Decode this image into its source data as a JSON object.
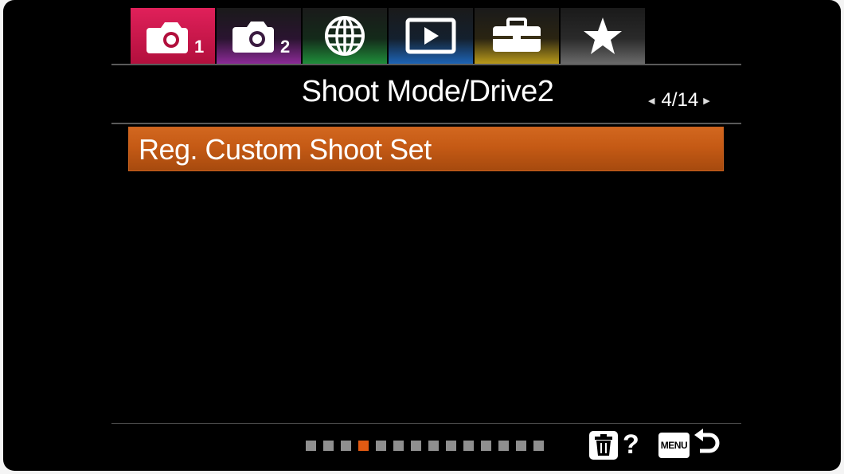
{
  "tabs": [
    {
      "icon": "camera-icon",
      "subscript": "1",
      "color": "#d4174d",
      "active": true
    },
    {
      "icon": "camera-icon",
      "subscript": "2",
      "color": "#8c2a97",
      "active": false
    },
    {
      "icon": "globe-icon",
      "subscript": "",
      "color": "#1f8e3a",
      "active": false
    },
    {
      "icon": "playback-icon",
      "subscript": "",
      "color": "#1d64b5",
      "active": false
    },
    {
      "icon": "toolbox-icon",
      "subscript": "",
      "color": "#b99a1a",
      "active": false
    },
    {
      "icon": "star-icon",
      "subscript": "",
      "color": "#7a7a7a",
      "active": false
    }
  ],
  "header": {
    "title": "Shoot Mode/Drive2",
    "page_current": "4",
    "page_total": "14",
    "page_label": "4/14"
  },
  "menu": {
    "items": [
      {
        "label": "Reg. Custom Shoot Set",
        "selected": true,
        "color": "#c55a15"
      }
    ]
  },
  "footer": {
    "page_dots_total": 14,
    "page_dots_active_index": 3,
    "help_label": "?",
    "menu_key_label": "MENU",
    "trash_icon": "trash-icon",
    "back_icon": "back-arrow-icon"
  }
}
